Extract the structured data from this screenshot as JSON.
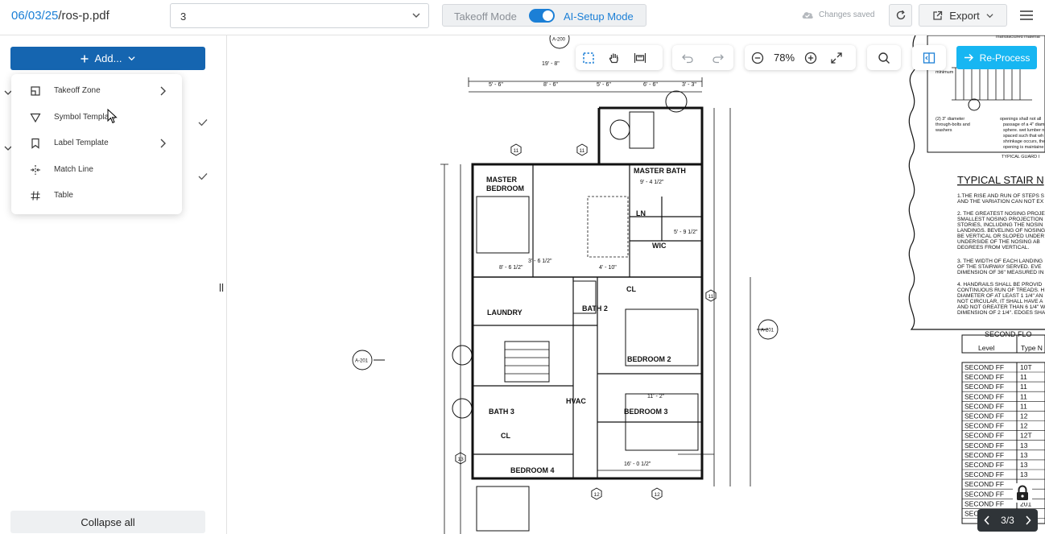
{
  "header": {
    "file_date": "06/03/25",
    "file_name": "/ros-p.pdf",
    "page_select_value": "3",
    "mode_left": "Takeoff Mode",
    "mode_right": "AI-Setup Mode",
    "mode_toggle_on": true,
    "saved_status": "Changes saved",
    "export_label": "Export"
  },
  "sidebar": {
    "add_label": "Add...",
    "menu_items": [
      {
        "label": "Takeoff Zone",
        "icon": "zone-icon",
        "has_submenu": true
      },
      {
        "label": "Symbol Template",
        "icon": "triangle-icon",
        "has_submenu": false
      },
      {
        "label": "Label Template",
        "icon": "bookmark-icon",
        "has_submenu": true
      },
      {
        "label": "Match Line",
        "icon": "match-line-icon",
        "has_submenu": false
      },
      {
        "label": "Table",
        "icon": "hash-icon",
        "has_submenu": false
      }
    ],
    "collapse_label": "Collapse all"
  },
  "viewer": {
    "zoom": "78%",
    "reprocess_label": "Re-Process",
    "pager": "3/3"
  },
  "plan": {
    "rooms": [
      "MASTER BEDROOM",
      "MASTER BATH",
      "LN",
      "WIC",
      "LAUNDRY",
      "BATH 2",
      "CL",
      "BEDROOM 2",
      "HVAC",
      "BATH 3",
      "BEDROOM 3",
      "CL",
      "BEDROOM 4"
    ],
    "callouts": [
      "A-200",
      "A-201",
      "A-201"
    ],
    "dims": [
      "19' - 8\"",
      "5' - 6\"",
      "8' - 6\"",
      "5' - 6\"",
      "6' - 6\"",
      "3' - 3\"",
      "9' - 4 1/2\"",
      "3' - 6 1/2\"",
      "8' - 6 1/2\"",
      "4' - 10\"",
      "5' - 9 1/2\"",
      "11' - 2\"",
      "16' - 0 1/2\""
    ],
    "grid_tags": [
      "11",
      "11",
      "11",
      "12",
      "12",
      "13"
    ],
    "notes_title": "TYPICAL STAIR N",
    "notes": [
      "1.THE RISE AND RUN OF STEPS S",
      "AND THE VARIATION CAN NOT EX",
      "2. THE GREATEST NOSING PROJE",
      "SMALLEST NOSING PROJECTION",
      "STORIES, INCLUDING THE NOSIN",
      "LANDINGS. BEVELING OF NOSING",
      "BE VERTICAL OR SLOPED UNDER",
      "UNDERSIDE OF THE NOSING AB",
      "DEGREES FROM VERTICAL.",
      "3. THE WIDTH OF EACH LANDING",
      "OF THE STAIRWAY SERVED. EVE",
      "DIMENSION OF 36\" MEASURED IN",
      "4. HANDRAILS SHALL BE PROVID",
      "CONTINUOUS RUN OF TREADS. H",
      "DIAMETER OF AT LEAST 1 1/4\" AN",
      "NOT CIRCULAR, IT SHALL HAVE A",
      "AND NOT GREATER THAN 6 1/4\" W",
      "DIMENSION OF 2 1/4\". EDGES SHA"
    ],
    "table_title": "SECOND FLO",
    "table_headers": [
      "Level",
      "Type N"
    ],
    "table_rows": [
      [
        "SECOND FF",
        "10T"
      ],
      [
        "SECOND FF",
        "11"
      ],
      [
        "SECOND FF",
        "11"
      ],
      [
        "SECOND FF",
        "11"
      ],
      [
        "SECOND FF",
        "11"
      ],
      [
        "SECOND FF",
        "12"
      ],
      [
        "SECOND FF",
        "12"
      ],
      [
        "SECOND FF",
        "12T"
      ],
      [
        "SECOND FF",
        "13"
      ],
      [
        "SECOND FF",
        "13"
      ],
      [
        "SECOND FF",
        "13"
      ],
      [
        "SECOND FF",
        "13"
      ],
      [
        "SECOND FF",
        ""
      ],
      [
        "SECOND FF",
        ""
      ],
      [
        "SECOND FF",
        "201"
      ],
      [
        "SEC",
        ""
      ]
    ],
    "detail_text": [
      "manufactured material",
      "minimum",
      "(2) 3\" diameter",
      "through-bolts and",
      "washers",
      "openings shall not all",
      "passage of a 4\" diam",
      "sphere. wet lumber n",
      "spaced such that wh",
      "shrinkage occurs, the",
      "opening is maintaine",
      "TYPICAL GUARD I"
    ]
  }
}
